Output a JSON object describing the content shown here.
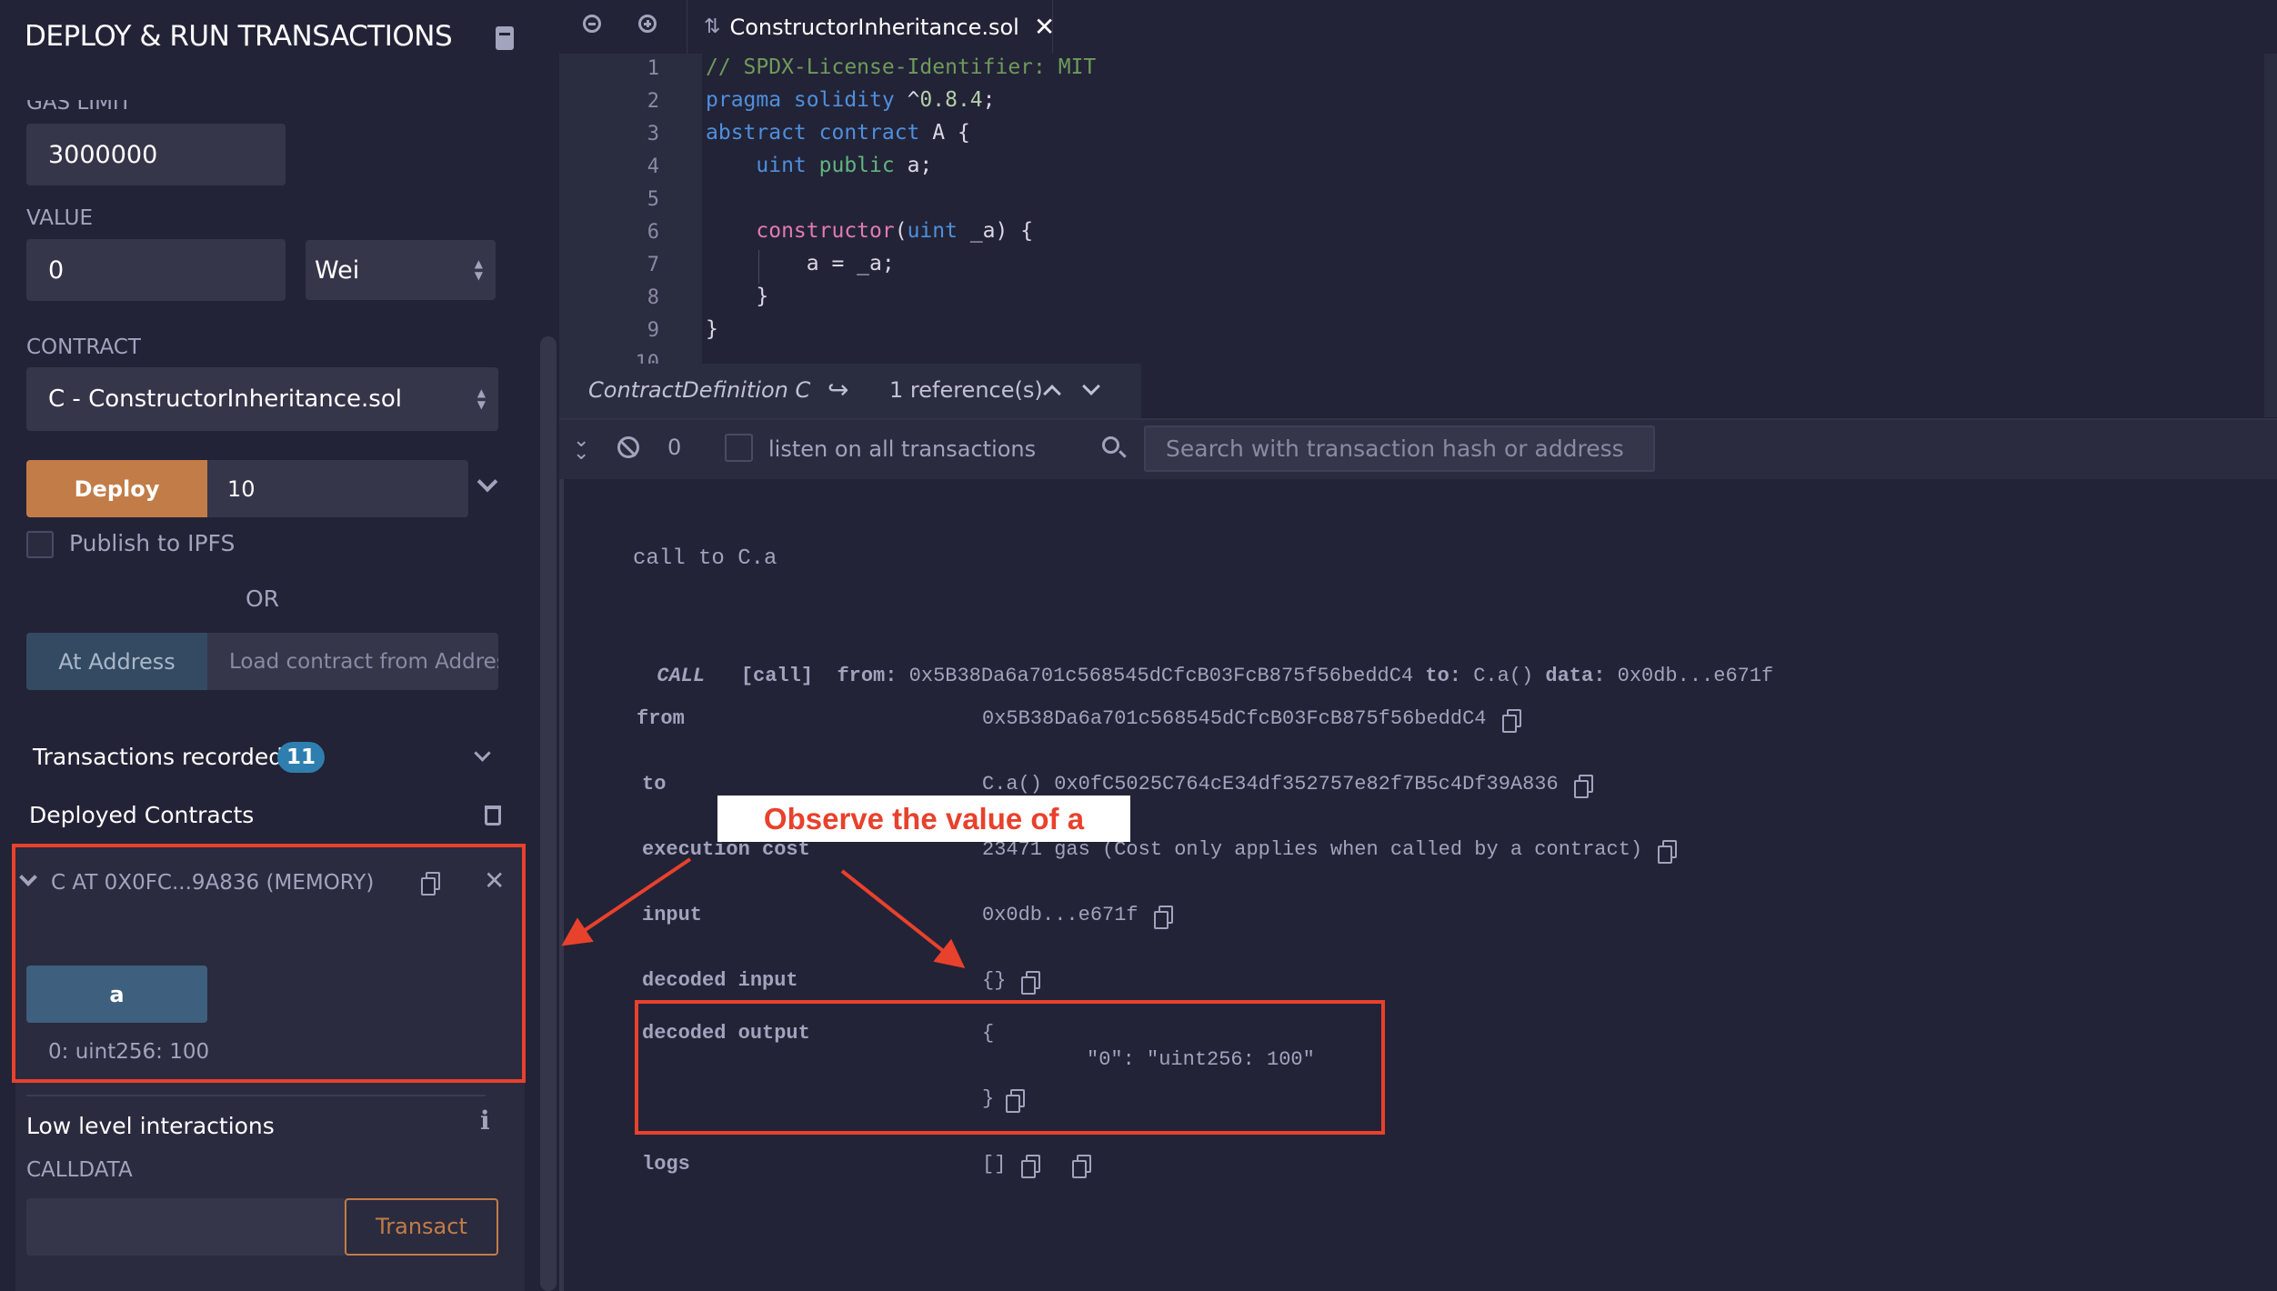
{
  "left_panel": {
    "title": "DEPLOY & RUN TRANSACTIONS",
    "title_icon": "book-icon",
    "gas_limit": {
      "label": "GAS LIMIT",
      "value": "3000000"
    },
    "value": {
      "label": "VALUE",
      "amount": "0",
      "unit": "Wei"
    },
    "contract": {
      "label": "CONTRACT",
      "selected": "C - ConstructorInheritance.sol"
    },
    "deploy": {
      "label": "Deploy",
      "args": "10"
    },
    "publish_ipfs": {
      "label": "Publish to IPFS",
      "checked": false
    },
    "or_label": "OR",
    "at_address": {
      "label": "At Address",
      "placeholder": "Load contract from Address"
    },
    "transactions_recorded": {
      "label": "Transactions recorded",
      "count": "11"
    },
    "deployed_contracts": {
      "label": "Deployed Contracts",
      "instance": {
        "title": "C AT 0X0FC...9A836 (MEMORY)",
        "function_button": "a",
        "result": "0: uint256: 100"
      }
    },
    "low_level": {
      "label": "Low level interactions",
      "calldata_label": "CALLDATA",
      "transact_label": "Transact"
    }
  },
  "editor": {
    "tab": {
      "filename": "ConstructorInheritance.sol"
    },
    "lines": [
      {
        "n": "1",
        "tokens": [
          [
            "comment",
            "// SPDX-License-Identifier: MIT"
          ]
        ]
      },
      {
        "n": "2",
        "tokens": [
          [
            "kw",
            "pragma solidity "
          ],
          [
            "plain",
            "^"
          ],
          [
            "num",
            "0.8.4"
          ],
          [
            "plain",
            ";"
          ]
        ]
      },
      {
        "n": "3",
        "tokens": [
          [
            "kw",
            "abstract contract "
          ],
          [
            "plain",
            "A {"
          ]
        ]
      },
      {
        "n": "4",
        "tokens": [
          [
            "plain",
            "    "
          ],
          [
            "kw",
            "uint "
          ],
          [
            "pub",
            "public "
          ],
          [
            "plain",
            "a;"
          ]
        ]
      },
      {
        "n": "5",
        "tokens": []
      },
      {
        "n": "6",
        "tokens": [
          [
            "plain",
            "    "
          ],
          [
            "fn",
            "constructor"
          ],
          [
            "plain",
            "("
          ],
          [
            "kw",
            "uint"
          ],
          [
            "plain",
            " _a) {"
          ]
        ]
      },
      {
        "n": "7",
        "tokens": [
          [
            "plain",
            "        a = _a;"
          ]
        ]
      },
      {
        "n": "8",
        "tokens": [
          [
            "plain",
            "    }"
          ]
        ]
      },
      {
        "n": "9",
        "tokens": [
          [
            "plain",
            "}"
          ]
        ]
      },
      {
        "n": "10",
        "tokens": []
      }
    ],
    "context_bar": {
      "definition": "ContractDefinition C",
      "references": "1 reference(s)"
    }
  },
  "terminal": {
    "pending_count": "0",
    "listen_label": "listen on all transactions",
    "search_placeholder": "Search with transaction hash or address",
    "call_header": "call to C.a",
    "call_line": {
      "type": "CALL",
      "tag": "[call]",
      "from_key": "from:",
      "from": "0x5B38Da6a701c568545dCfcB03FcB875f56beddC4",
      "to_key": "to:",
      "to": "C.a()",
      "data_key": "data:",
      "data": "0x0db...e671f"
    },
    "rows": {
      "from": {
        "label": "from",
        "value": "0x5B38Da6a701c568545dCfcB03FcB875f56beddC4"
      },
      "to": {
        "label": "to",
        "value": "C.a() 0x0fC5025C764cE34df352757e82f7B5c4Df39A836"
      },
      "execution_cost": {
        "label": "execution cost",
        "value": "23471 gas (Cost only applies when called by a contract)"
      },
      "input": {
        "label": "input",
        "value": "0x0db...e671f"
      },
      "decoded_input": {
        "label": "decoded input",
        "value": "{}"
      },
      "decoded_output": {
        "label": "decoded output",
        "open": "{",
        "entry": "\"0\": \"uint256: 100\"",
        "close": "}"
      },
      "logs": {
        "label": "logs",
        "value": "[]"
      }
    }
  },
  "annotation": {
    "callout": "Observe the value of a",
    "color": "#e8412c"
  }
}
